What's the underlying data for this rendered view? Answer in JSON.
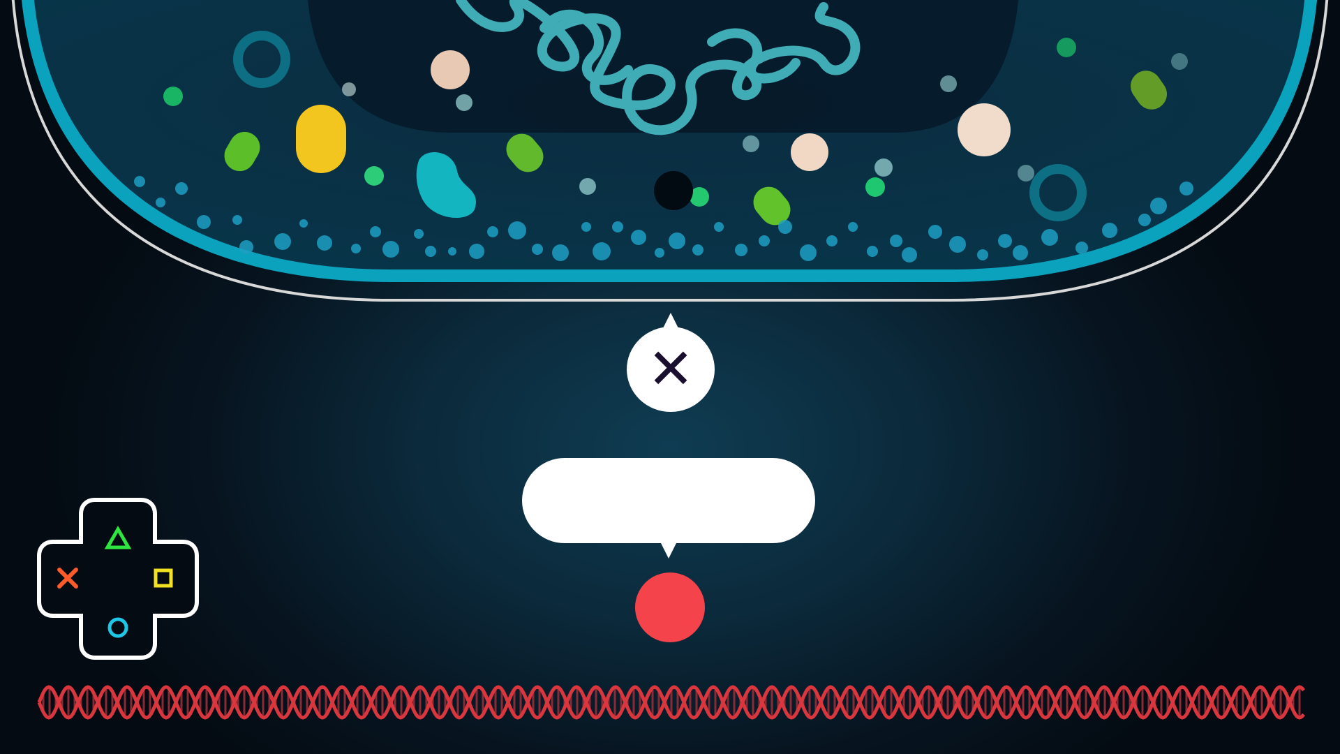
{
  "scene": {
    "description_title": "",
    "colors": {
      "background": "#071521",
      "cell_membrane": "#0aa2bd",
      "cell_outline": "#d8d8d8",
      "chromosome": "#4fd1d9",
      "dna_strand": "#d9363e",
      "record_dot": "#f4434b",
      "bubble": "#ffffff",
      "close_glyph": "#1a0f2e"
    }
  },
  "prompt_bubble": {
    "icon": "close-icon",
    "glyph": "✕"
  },
  "dialogue": {
    "text": ""
  },
  "record_indicator": {
    "icon": "record-dot-icon"
  },
  "controller": {
    "icon": "dpad-icon",
    "buttons": [
      {
        "name": "triangle",
        "color": "#2fe53f"
      },
      {
        "name": "square",
        "color": "#f2e120"
      },
      {
        "name": "cross",
        "color": "#ff5a2a"
      },
      {
        "name": "circle",
        "color": "#1fc7e6"
      }
    ]
  },
  "dna_strand": {
    "icon": "dna-helix-icon"
  }
}
